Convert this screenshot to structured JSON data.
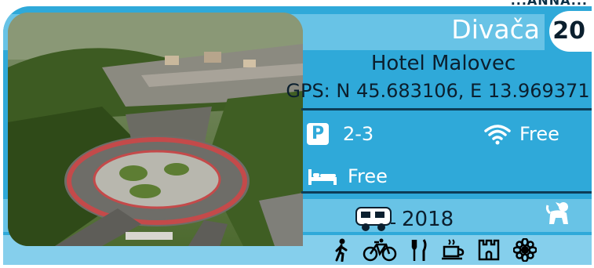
{
  "header": {
    "corner_text": "...ANNA..."
  },
  "card": {
    "title": "Divača",
    "number": "20",
    "name": "Hotel Malovec",
    "gps": "GPS: N 45.683106, E 13.969371",
    "parking": "2-3",
    "wifi": "Free",
    "beds": "Free",
    "year": "2018"
  },
  "icons": [
    "parking-icon",
    "wifi-icon",
    "bed-icon",
    "caravan-icon",
    "dog-icon",
    "hiking-icon",
    "bicycle-icon",
    "restaurant-icon",
    "coffee-icon",
    "castle-icon",
    "flower-icon"
  ],
  "colors": {
    "card": "#2fa9d9",
    "band": "#68c3e6",
    "dark": "#0b1f2e",
    "white": "#ffffff"
  }
}
